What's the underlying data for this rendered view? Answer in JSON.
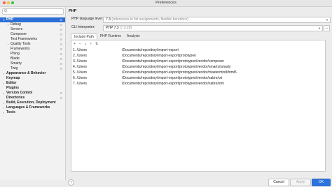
{
  "window": {
    "title": "Preferences"
  },
  "sidebar": {
    "search_glyph": "Q",
    "items": [
      {
        "label": "PHP",
        "arrow": "▾",
        "bold": true,
        "selected": true,
        "gear": true
      },
      {
        "label": "Debug",
        "arrow": "›",
        "gear": true
      },
      {
        "label": "Servers",
        "gear": true
      },
      {
        "label": "Composer",
        "gear": true
      },
      {
        "label": "Test Frameworks",
        "gear": true
      },
      {
        "label": "Quality Tools",
        "arrow": "›",
        "gear": true
      },
      {
        "label": "Frameworks",
        "gear": true
      },
      {
        "label": "Phing",
        "gear": true
      },
      {
        "label": "Blade",
        "gear": true
      },
      {
        "label": "Smarty",
        "gear": true
      },
      {
        "label": "Twig",
        "gear": true
      },
      {
        "label": "Appearance & Behavior",
        "arrow": "›",
        "bold": true
      },
      {
        "label": "Keymap",
        "bold": true
      },
      {
        "label": "Editor",
        "arrow": "›",
        "bold": true
      },
      {
        "label": "Plugins",
        "bold": true
      },
      {
        "label": "Version Control",
        "arrow": "›",
        "bold": true,
        "gear": true
      },
      {
        "label": "Directories",
        "bold": true,
        "gear": true
      },
      {
        "label": "Build, Execution, Deployment",
        "arrow": "›",
        "bold": true
      },
      {
        "label": "Languages & Frameworks",
        "arrow": "›",
        "bold": true
      },
      {
        "label": "Tools",
        "arrow": "›",
        "bold": true
      }
    ]
  },
  "main": {
    "breadcrumb": "PHP",
    "language_level": {
      "label": "PHP language level:",
      "value": "7.3",
      "hint": "(references in list assignments, flexible heredocs)"
    },
    "cli_interpreter": {
      "label": "CLI Interpreter:",
      "value": "PHP 7.3",
      "hint": "(7.3.28)",
      "browse": "..."
    },
    "tabs": [
      "Include Path",
      "PHP Runtime",
      "Analysis"
    ],
    "active_tab": 0,
    "toolbar": [
      "+",
      "−",
      "▴",
      "▾",
      "⇅"
    ],
    "include_paths": [
      {
        "num": "1.",
        "user": "/Users",
        "path": "/Documents/repository/import-export"
      },
      {
        "num": "2.",
        "user": "/Users",
        "path": "/Documents/repository/import-export/prototypen"
      },
      {
        "num": "3.",
        "user": "/Users",
        "path": "/Documents/repository/import-export/prototypen/vendor/composer"
      },
      {
        "num": "4.",
        "user": "/Users",
        "path": "/Documents/repository/import-export/prototypen/vendor/smarty/smarty"
      },
      {
        "num": "5.",
        "user": "/Users",
        "path": "/Documents/repository/import-export/prototypen/vendor/mastermind/html5"
      },
      {
        "num": "6.",
        "user": "/Users",
        "path": "/Documents/repository/import-export/prototypen/vendor/sabre/uri"
      },
      {
        "num": "7.",
        "user": "/Users",
        "path": "/Documents/repository/import-export/prototypen/vendor/sabre/xml"
      }
    ]
  },
  "footer": {
    "help": "?",
    "cancel": "Cancel",
    "apply": "Apply",
    "ok": "OK"
  },
  "colors": {
    "selection": "#2b6fd6",
    "primary_button": "#2d74de"
  }
}
